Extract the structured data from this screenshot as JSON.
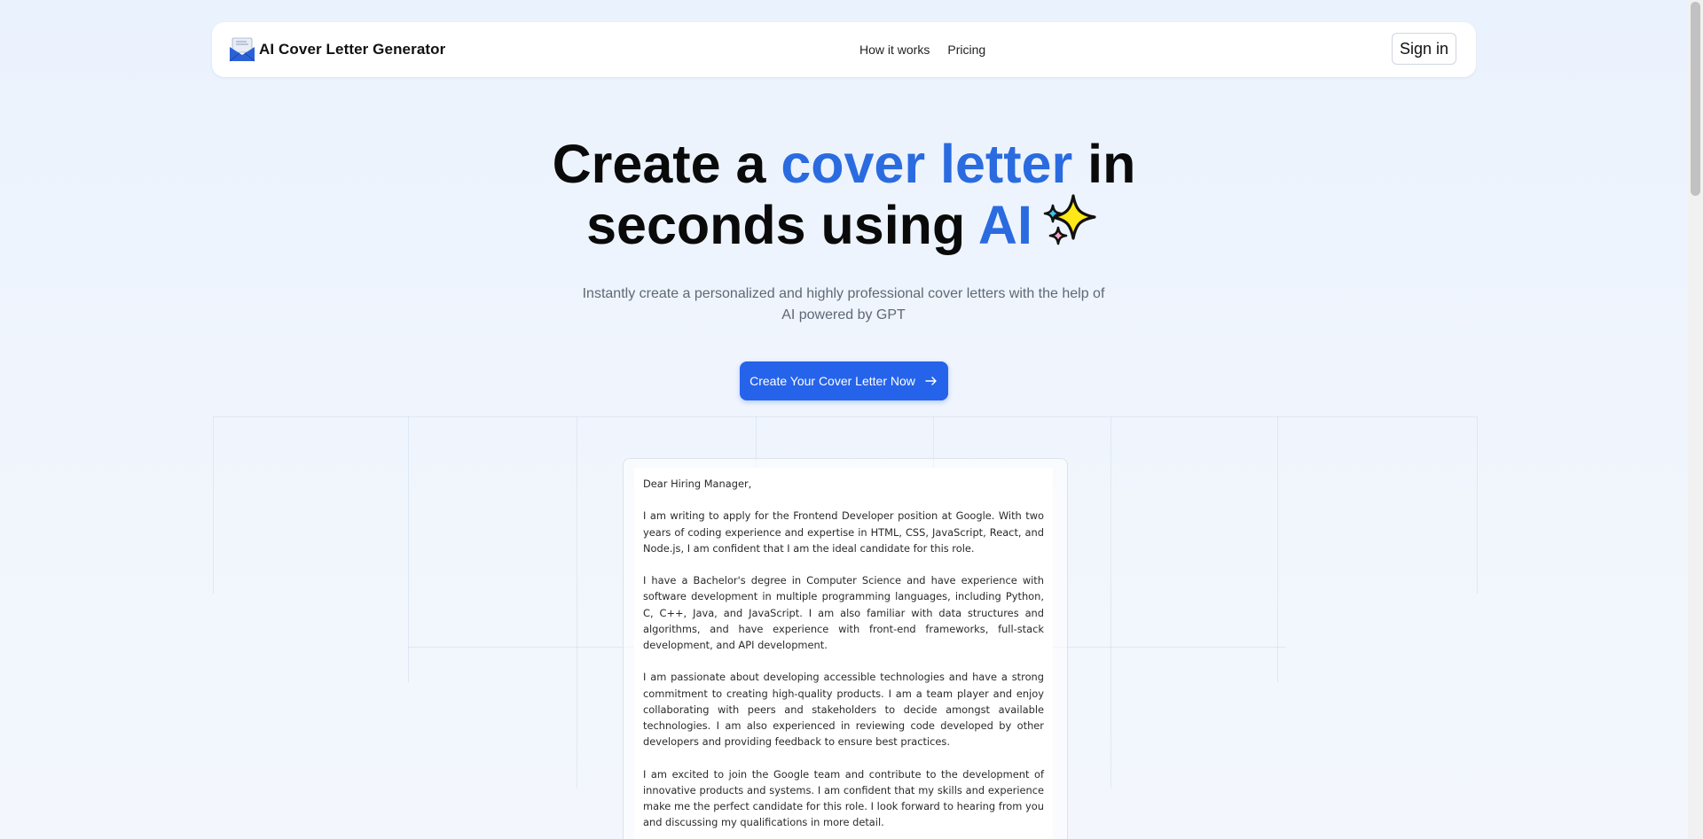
{
  "header": {
    "brand_name": "AI Cover Letter Generator",
    "nav": [
      {
        "label": "How it works"
      },
      {
        "label": "Pricing"
      }
    ],
    "signin_label": "Sign in"
  },
  "hero": {
    "title_part1": "Create a ",
    "title_accent1": "cover letter",
    "title_part2": " in",
    "title_part3": "seconds using ",
    "title_accent2": "AI",
    "subtitle": "Instantly create a personalized and highly professional cover letters with the help of AI powered by GPT",
    "cta_label": "Create Your Cover Letter Now",
    "accent_color": "#2a6be0",
    "cta_color": "#2563eb"
  },
  "letter": {
    "greeting": "Dear Hiring Manager,",
    "paragraphs": [
      "I am writing to apply for the Frontend Developer position at Google. With two years of coding experience and expertise in HTML, CSS, JavaScript, React, and Node.js, I am confident that I am the ideal candidate for this role.",
      "I have a Bachelor's degree in Computer Science and have experience with software development in multiple programming languages, including Python, C, C++, Java, and JavaScript. I am also familiar with data structures and algorithms, and have experience with front-end frameworks, full-stack development, and API development.",
      "I am passionate about developing accessible technologies and have a strong commitment to creating high-quality products. I am a team player and enjoy collaborating with peers and stakeholders to decide amongst available technologies. I am also experienced in reviewing code developed by other developers and providing feedback to ensure best practices.",
      "I am excited to join the Google team and contribute to the development of innovative products and systems. I am confident that my skills and experience make me the perfect candidate for this role. I look forward to hearing from you and discussing my qualifications in more detail."
    ]
  },
  "icons": {
    "brand": "envelope-icon",
    "sparkle": "sparkles-icon",
    "cta": "arrow-right-icon"
  }
}
